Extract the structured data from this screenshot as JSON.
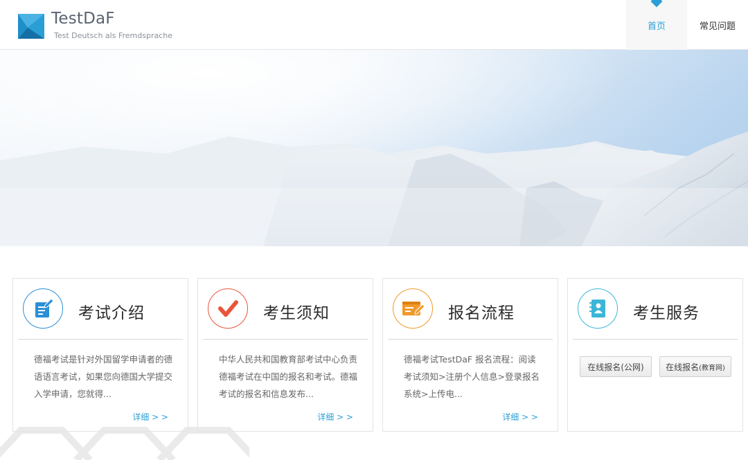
{
  "header": {
    "logo_title": "TestDaF",
    "logo_subtitle": "Test Deutsch als Fremdsprache",
    "nav": [
      {
        "label": "首页",
        "active": true
      },
      {
        "label": "常见问题",
        "active": false
      }
    ]
  },
  "cards": [
    {
      "title": "考试介绍",
      "icon": "edit-document-icon",
      "text": "德福考试是针对外国留学申请者的德语语言考试，如果您向德国大学提交入学申请，您就得...",
      "more": "详细 > >"
    },
    {
      "title": "考生须知",
      "icon": "checkmark-icon",
      "text": "中华人民共和国教育部考试中心负责德福考试在中国的报名和考试。德福考试的报名和信息发布...",
      "more": "详细 > >"
    },
    {
      "title": "报名流程",
      "icon": "form-pen-icon",
      "text": "德福考试TestDaF 报名流程：阅读考试须知>注册个人信息>登录报名系统>上传电...",
      "more": "详细 > >"
    },
    {
      "title": "考生服务",
      "icon": "contact-book-icon",
      "buttons": [
        {
          "main": "在线报名",
          "suffix": "(公网)"
        },
        {
          "main": "在线报名",
          "suffix": "(教育网)"
        }
      ]
    }
  ],
  "colors": {
    "accent": "#2a9fd6",
    "card_icon_1": "#2a8fd6",
    "card_icon_2": "#e8553a",
    "card_icon_3": "#f09a2a",
    "card_icon_4": "#3bb6d8"
  }
}
